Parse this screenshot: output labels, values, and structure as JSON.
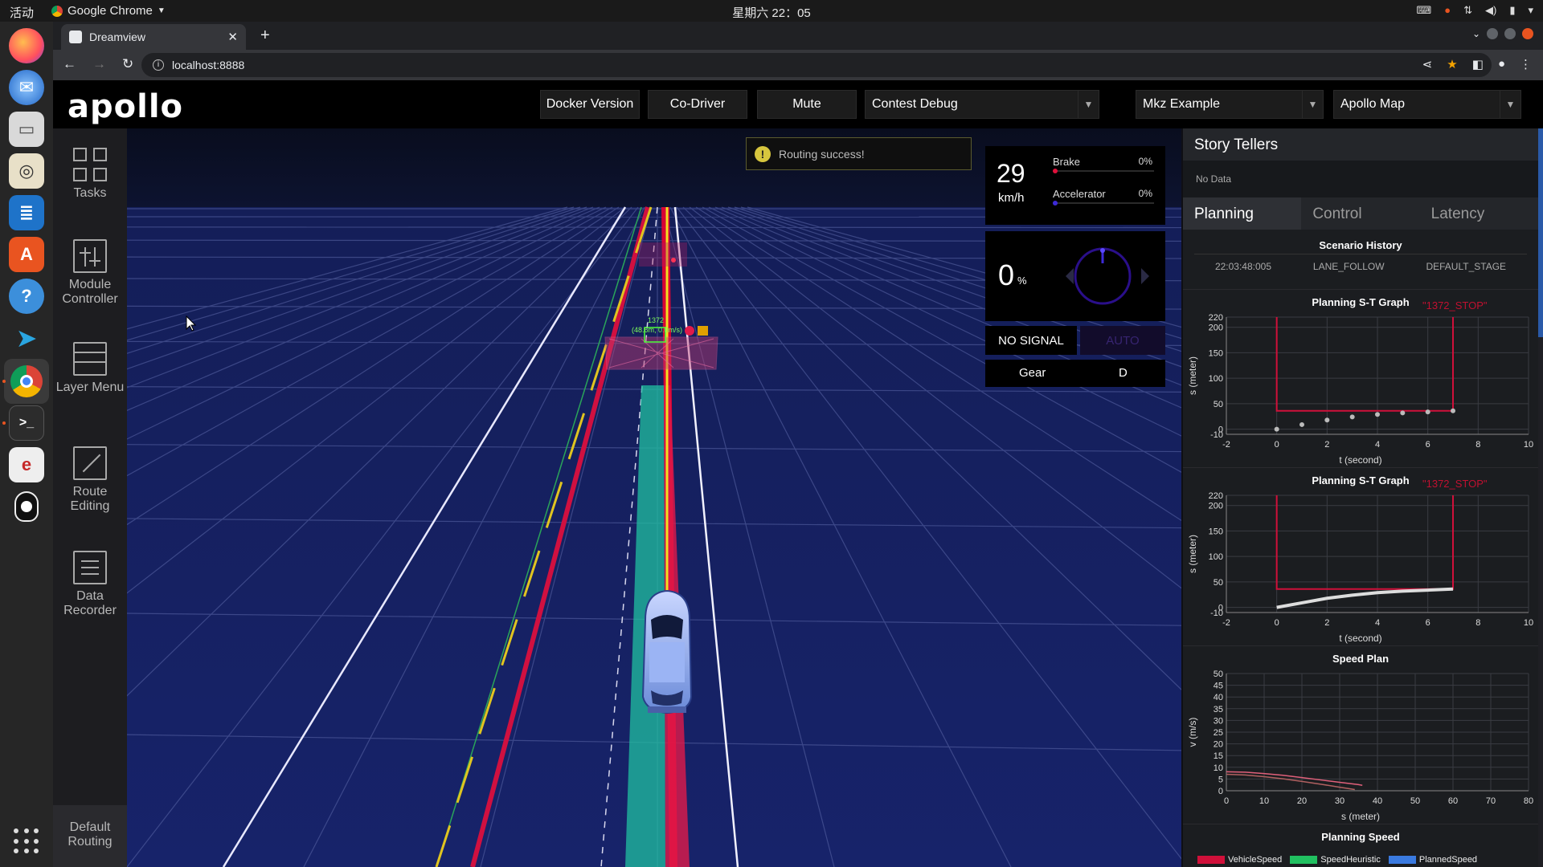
{
  "os": {
    "activities": "活动",
    "active_app": "Google Chrome",
    "clock": "星期六 22：05",
    "dock_icons": [
      "firefox-icon",
      "thunderbird-icon",
      "files-icon",
      "rhythmbox-icon",
      "writer-icon",
      "software-center-icon",
      "help-icon",
      "telegram-icon",
      "chrome-icon",
      "terminal-icon",
      "viewer-icon",
      "qq-icon"
    ]
  },
  "browser": {
    "tab_title": "Dreamview",
    "url": "localhost:8888"
  },
  "header": {
    "logo": "apollo",
    "buttons": [
      "Docker Version",
      "Co-Driver",
      "Mute"
    ],
    "mode_select": "Contest Debug",
    "vehicle_select": "Mkz Example",
    "map_select": "Apollo Map"
  },
  "side_menu": {
    "tasks": "Tasks",
    "module_controller": "Module Controller",
    "layer_menu": "Layer Menu",
    "route_editing": "Route Editing",
    "data_recorder": "Data Recorder",
    "default_routing": "Default Routing"
  },
  "notification": "Routing success!",
  "scene": {
    "obstacle_id": "1372",
    "obstacle_label": "(48.6m, 0.0m/s)"
  },
  "dashboard": {
    "speed": "29",
    "speed_unit": "km/h",
    "brake_label": "Brake",
    "brake_pct": "0%",
    "brake_level": 0,
    "accel_label": "Accelerator",
    "accel_pct": "0%",
    "accel_level": 0,
    "steering": "0",
    "steering_unit": "%",
    "signal": "NO SIGNAL",
    "driving_mode": "AUTO",
    "gear_label": "Gear",
    "gear": "D",
    "colors": {
      "brake": "#e0103a",
      "accelerator": "#3d2ad8",
      "auto_text": "#372470"
    }
  },
  "story_tellers": {
    "title": "Story Tellers",
    "content": "No Data"
  },
  "tabs": [
    "Planning",
    "Control",
    "Latency"
  ],
  "scenario_history": {
    "title": "Scenario History",
    "row": [
      "22:03:48:005",
      "LANE_FOLLOW",
      "DEFAULT_STAGE"
    ]
  },
  "charts": {
    "st_graph_1": {
      "title": "Planning S-T Graph",
      "annotation": "1372_STOP",
      "xlabel": "t (second)",
      "ylabel": "s (meter)"
    },
    "st_graph_2": {
      "title": "Planning S-T Graph",
      "annotation": "1372_STOP",
      "xlabel": "t (second)",
      "ylabel": "s (meter)"
    },
    "speed_plan": {
      "title": "Speed Plan",
      "xlabel": "s (meter)",
      "ylabel": "v (m/s)"
    },
    "planning_speed": {
      "title": "Planning Speed",
      "legend": [
        "VehicleSpeed",
        "SpeedHeuristic",
        "PlannedSpeed"
      ]
    }
  },
  "chart_data": [
    {
      "type": "scatter",
      "title": "Planning S-T Graph",
      "xlabel": "t (second)",
      "ylabel": "s (meter)",
      "xlim": [
        -2,
        10
      ],
      "ylim": [
        -10,
        220
      ],
      "x_ticks": [
        "-2",
        "0",
        "2",
        "4",
        "6",
        "8",
        "10"
      ],
      "y_ticks": [
        "-10",
        "0",
        "50",
        "100",
        "150",
        "200",
        "220"
      ],
      "boundary": {
        "t": [
          0,
          0,
          7,
          7
        ],
        "s": [
          220,
          36,
          36,
          220
        ],
        "color": "#d0103a"
      },
      "series": [
        {
          "x": [
            0,
            1,
            2,
            3,
            4,
            5,
            6,
            7
          ],
          "values": [
            0,
            9,
            18,
            24,
            29,
            32,
            34,
            36
          ],
          "color": "#bbbbbb"
        }
      ]
    },
    {
      "type": "line",
      "title": "Planning S-T Graph",
      "xlabel": "t (second)",
      "ylabel": "s (meter)",
      "xlim": [
        -2,
        10
      ],
      "ylim": [
        -10,
        220
      ],
      "x_ticks": [
        "-2",
        "0",
        "2",
        "4",
        "6",
        "8",
        "10"
      ],
      "y_ticks": [
        "-10",
        "0",
        "50",
        "100",
        "150",
        "200",
        "220"
      ],
      "boundary": {
        "t": [
          0,
          0,
          7,
          7
        ],
        "s": [
          220,
          36,
          36,
          220
        ],
        "color": "#d0103a"
      },
      "series": [
        {
          "x": [
            0,
            1,
            2,
            3,
            4,
            5,
            6,
            7
          ],
          "values": [
            0,
            9,
            18,
            24,
            29,
            32,
            34,
            36
          ],
          "color": "#dddddd"
        }
      ]
    },
    {
      "type": "line",
      "title": "Speed Plan",
      "xlabel": "s (meter)",
      "ylabel": "v (m/s)",
      "xlim": [
        0,
        80
      ],
      "ylim": [
        0,
        50
      ],
      "x_ticks": [
        "0",
        "10",
        "20",
        "30",
        "40",
        "50",
        "60",
        "70",
        "80"
      ],
      "y_ticks": [
        "0",
        "5",
        "10",
        "15",
        "20",
        "25",
        "30",
        "35",
        "40",
        "45",
        "50"
      ],
      "series": [
        {
          "x": [
            0,
            5,
            10,
            15,
            20,
            25,
            30,
            35,
            36
          ],
          "values": [
            8.1,
            7.9,
            7.3,
            6.6,
            5.6,
            4.6,
            3.6,
            2.6,
            2.3
          ],
          "color": "#e0607a"
        },
        {
          "x": [
            0,
            5,
            10,
            15,
            20,
            25,
            30,
            34
          ],
          "values": [
            7.0,
            6.7,
            6.0,
            5.1,
            4.0,
            2.8,
            1.5,
            0.5
          ],
          "color": "#b06060"
        }
      ]
    }
  ]
}
